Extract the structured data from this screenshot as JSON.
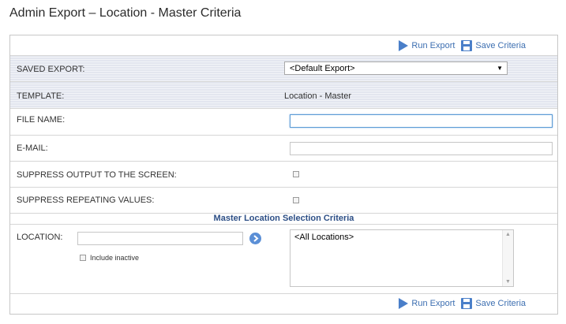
{
  "page": {
    "title": "Admin Export – Location - Master Criteria"
  },
  "toolbar": {
    "run_export": "Run Export",
    "save_criteria": "Save Criteria"
  },
  "form": {
    "saved_export": {
      "label": "SAVED EXPORT:",
      "selected": "<Default Export>"
    },
    "template": {
      "label": "TEMPLATE:",
      "value": "Location - Master"
    },
    "file_name": {
      "label": "FILE NAME:",
      "value": ""
    },
    "email": {
      "label": "E-MAIL:",
      "value": ""
    },
    "suppress_output": {
      "label": "SUPPRESS OUTPUT TO THE SCREEN:"
    },
    "suppress_repeating": {
      "label": "SUPPRESS REPEATING VALUES:"
    }
  },
  "criteria": {
    "heading": "Master Location Selection Criteria",
    "location_label": "LOCATION:",
    "location_value": "",
    "include_inactive": "Include inactive",
    "list_items": [
      "<All Locations>"
    ]
  },
  "colors": {
    "accent": "#3d6fb1",
    "heading": "#2d4f86",
    "stripe": "#e3e6ef"
  }
}
